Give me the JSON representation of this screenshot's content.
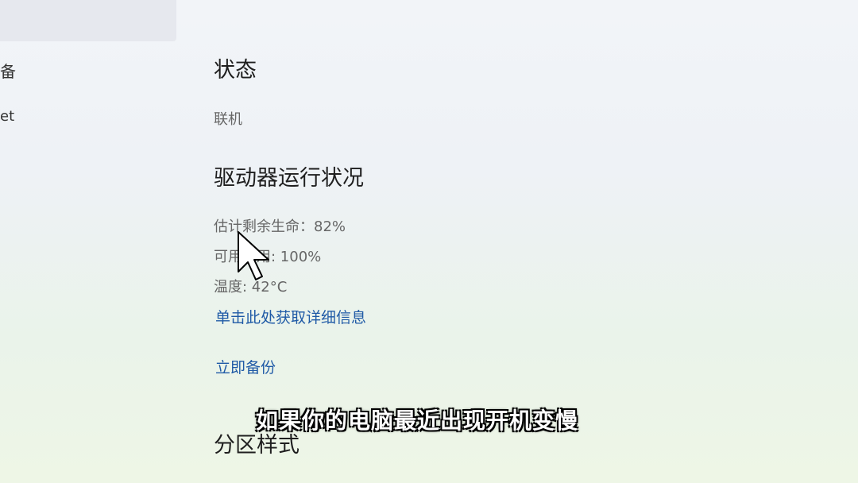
{
  "sidebar": {
    "item_1_fragment": "备",
    "item_2_fragment": "et"
  },
  "status_section": {
    "heading": "状态",
    "value": "联机"
  },
  "drive_health": {
    "heading": "驱动器运行状况",
    "estimated_life": "估计剩余生命：82%",
    "available_spare": "可用备用: 100%",
    "temperature": "温度: 42°C",
    "details_link": "单击此处获取详细信息"
  },
  "backup_link": "立即备份",
  "partition_section": {
    "heading": "分区样式"
  },
  "subtitle_caption": "如果你的电脑最近出现开机变慢"
}
